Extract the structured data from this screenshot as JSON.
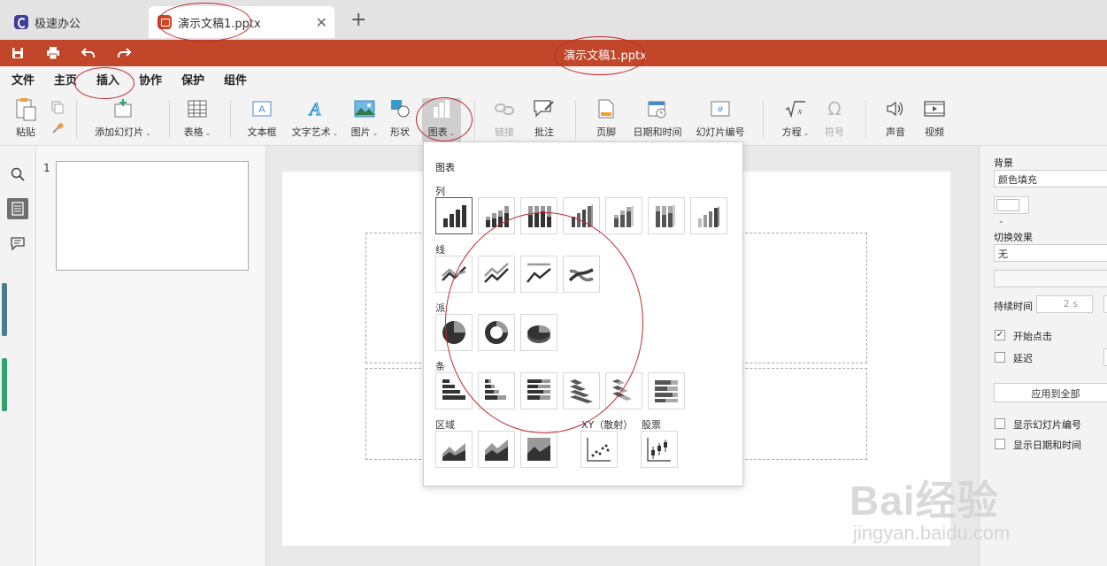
{
  "tabs": [
    {
      "label": "极速办公"
    },
    {
      "label": "演示文稿1.pptx"
    }
  ],
  "title": "演示文稿1.pptx",
  "menu": [
    "文件",
    "主页",
    "插入",
    "协作",
    "保护",
    "组件"
  ],
  "active_menu": "插入",
  "ribbon": {
    "paste": "粘贴",
    "add_slide": "添加幻灯片",
    "table": "表格",
    "textbox": "文本框",
    "wordart": "文字艺术",
    "image": "图片",
    "shape": "形状",
    "chart": "图表",
    "link": "链接",
    "comment": "批注",
    "footer": "页脚",
    "datetime": "日期和时间",
    "slide_number": "幻灯片编号",
    "equation": "方程",
    "symbol": "符号",
    "audio": "声音",
    "video": "视频"
  },
  "thumbnails": {
    "slide_number": "1"
  },
  "chart_menu": {
    "title": "图表",
    "sections": {
      "column": "列",
      "line": "线",
      "pie": "派",
      "bar": "条",
      "area": "区域",
      "scatter": "XY（散射）",
      "stock": "股票"
    }
  },
  "right_panel": {
    "background_label": "背景",
    "background_value": "颜色填充",
    "transition_label": "切换效果",
    "transition_value": "无",
    "duration_label": "持续时间",
    "duration_value": "2 s",
    "start_on_click": "开始点击",
    "delay": "延迟",
    "apply_all": "应用到全部",
    "show_slide_number": "显示幻灯片编号",
    "show_datetime": "显示日期和时间"
  },
  "watermark": {
    "brand": "Bai经验",
    "url": "jingyan.baidu.com"
  },
  "colors": {
    "accent": "#c1462a",
    "annotation": "#c0282d"
  }
}
